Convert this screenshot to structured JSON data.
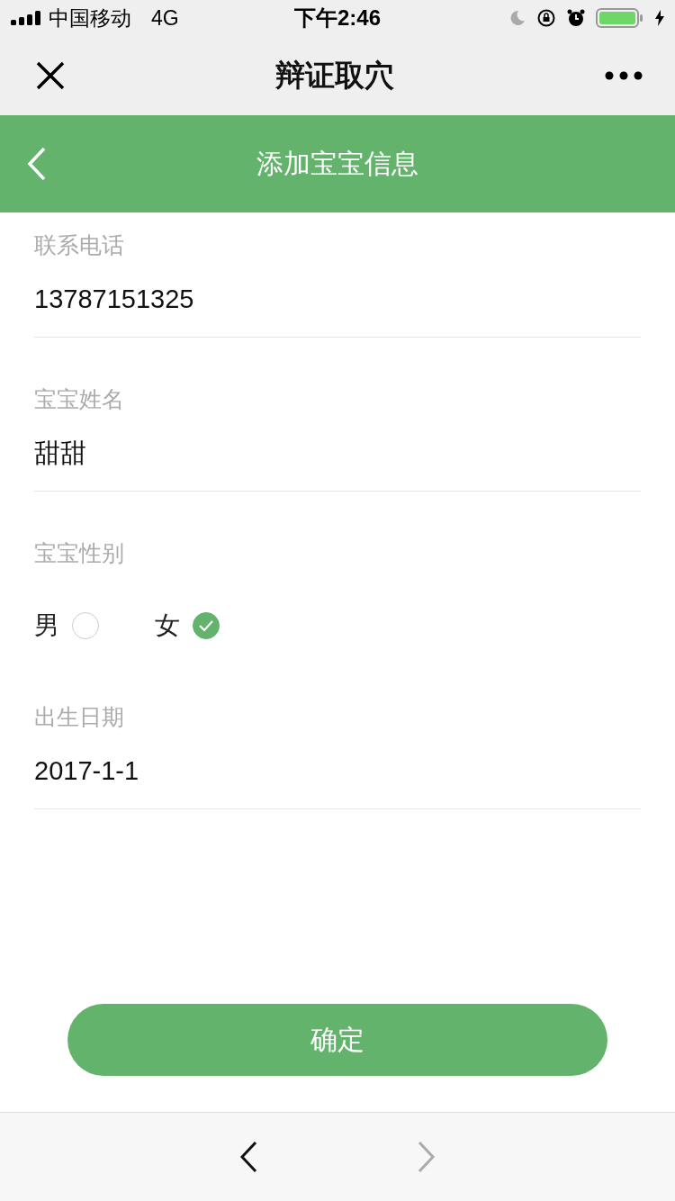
{
  "status_bar": {
    "carrier": "中国移动",
    "network": "4G",
    "time": "下午2:46"
  },
  "mini_program_bar": {
    "title": "辩证取穴"
  },
  "header": {
    "title": "添加宝宝信息"
  },
  "fields": [
    {
      "kind": "text",
      "label": "联系电话",
      "value": "13787151325"
    },
    {
      "kind": "text",
      "label": "宝宝姓名",
      "value": "甜甜"
    },
    {
      "kind": "radio",
      "label": "宝宝性别",
      "options": [
        {
          "label": "男",
          "selected": false
        },
        {
          "label": "女",
          "selected": true
        }
      ]
    },
    {
      "kind": "text",
      "label": "出生日期",
      "value": "2017-1-1"
    }
  ],
  "confirm_button": "确定",
  "browser_bar": {
    "back_disabled": false,
    "forward_disabled": true
  }
}
